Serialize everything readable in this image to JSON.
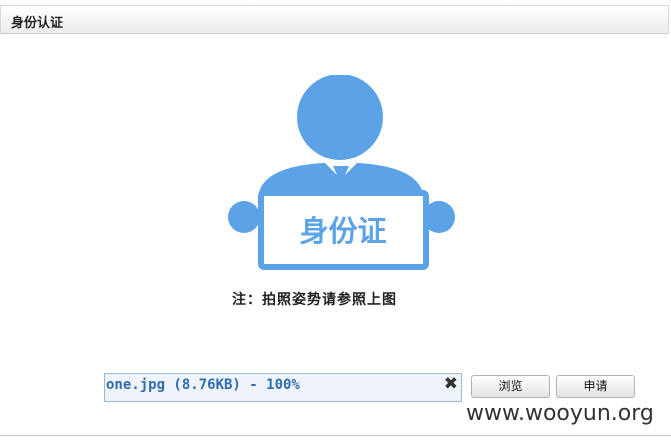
{
  "header": {
    "title": "身份认证"
  },
  "illustration": {
    "icon": "id-card-person-icon",
    "card_text": "身份证",
    "color": "#5ba3e6"
  },
  "note": "注：拍照姿势请参照上图",
  "upload": {
    "file_text": "one.jpg (8.76KB) - 100%",
    "close_symbol": "✖"
  },
  "buttons": {
    "browse": "浏览",
    "apply": "申请"
  },
  "watermark": "www.wooyun.org"
}
